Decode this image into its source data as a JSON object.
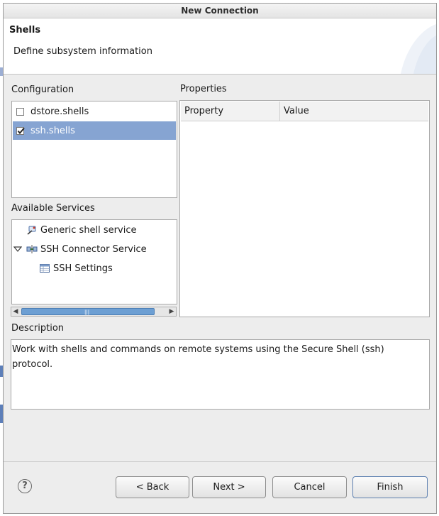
{
  "window": {
    "title": "New Connection"
  },
  "banner": {
    "title": "Shells",
    "description": "Define subsystem information"
  },
  "configuration": {
    "label": "Configuration",
    "items": [
      {
        "label": "dstore.shells",
        "checked": false
      },
      {
        "label": "ssh.shells",
        "checked": true
      }
    ]
  },
  "properties": {
    "label": "Properties",
    "columns": [
      "Property",
      "Value"
    ]
  },
  "services": {
    "label": "Available Services",
    "items": [
      {
        "label": "Generic shell service",
        "icon": "shell-service-icon"
      },
      {
        "label": "SSH Connector Service",
        "icon": "connector-service-icon",
        "expanded": true
      },
      {
        "label": "SSH Settings",
        "icon": "settings-table-icon"
      }
    ]
  },
  "description": {
    "label": "Description",
    "text": "Work with shells and commands on remote systems using the Secure Shell (ssh) protocol."
  },
  "buttons": {
    "help": "?",
    "back": "< Back",
    "next": "Next >",
    "cancel": "Cancel",
    "finish": "Finish"
  },
  "colors": {
    "selection": "#86a4d2",
    "scroll_thumb": "#6d9fd3",
    "dialog_bg": "#ededed"
  }
}
